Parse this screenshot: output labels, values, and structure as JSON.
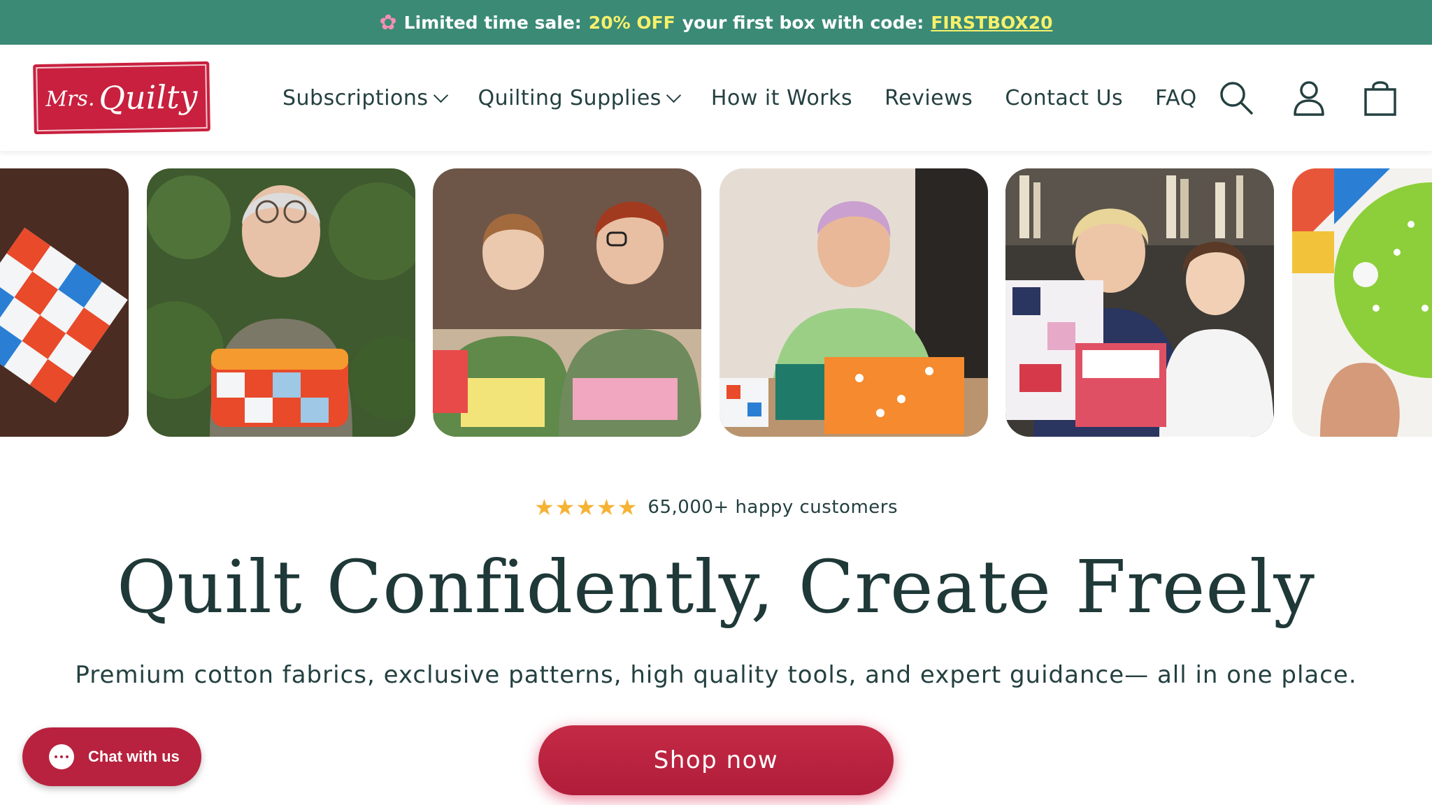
{
  "announcement": {
    "icon": "flower-icon",
    "prefix": "Limited time sale:",
    "highlight": "20% OFF",
    "middle": "your first box with code:",
    "code": "FIRSTBOX20"
  },
  "logo": {
    "part1": "Mrs.",
    "part2": "Quilty"
  },
  "nav": {
    "items": [
      {
        "label": "Subscriptions",
        "dropdown": true
      },
      {
        "label": "Quilting Supplies",
        "dropdown": true
      },
      {
        "label": "How it Works",
        "dropdown": false
      },
      {
        "label": "Reviews",
        "dropdown": false
      },
      {
        "label": "Contact Us",
        "dropdown": false
      },
      {
        "label": "FAQ",
        "dropdown": false
      }
    ],
    "icons": [
      "search-icon",
      "account-icon",
      "cart-icon"
    ]
  },
  "carousel": {
    "slides": [
      "patchwork-pillow-photo",
      "woman-holding-fabric-basket-photo",
      "girl-and-woman-sewing-photo",
      "woman-cutting-fabric-photo",
      "grandmother-and-granddaughter-photo",
      "green-pincushion-photo"
    ]
  },
  "hero": {
    "rating_stars": 5,
    "rating_text": "65,000+ happy customers",
    "headline": "Quilt Confidently, Create Freely",
    "subline": "Premium cotton fabrics, exclusive patterns, high quality tools, and expert guidance— all in one place.",
    "cta": "Shop now"
  },
  "chat": {
    "label": "Chat with us"
  },
  "colors": {
    "announce_bg": "#3a8a76",
    "announce_highlight": "#f6f06a",
    "brand_red": "#c8203e",
    "text_dark": "#1f3838",
    "star": "#f5b335"
  }
}
